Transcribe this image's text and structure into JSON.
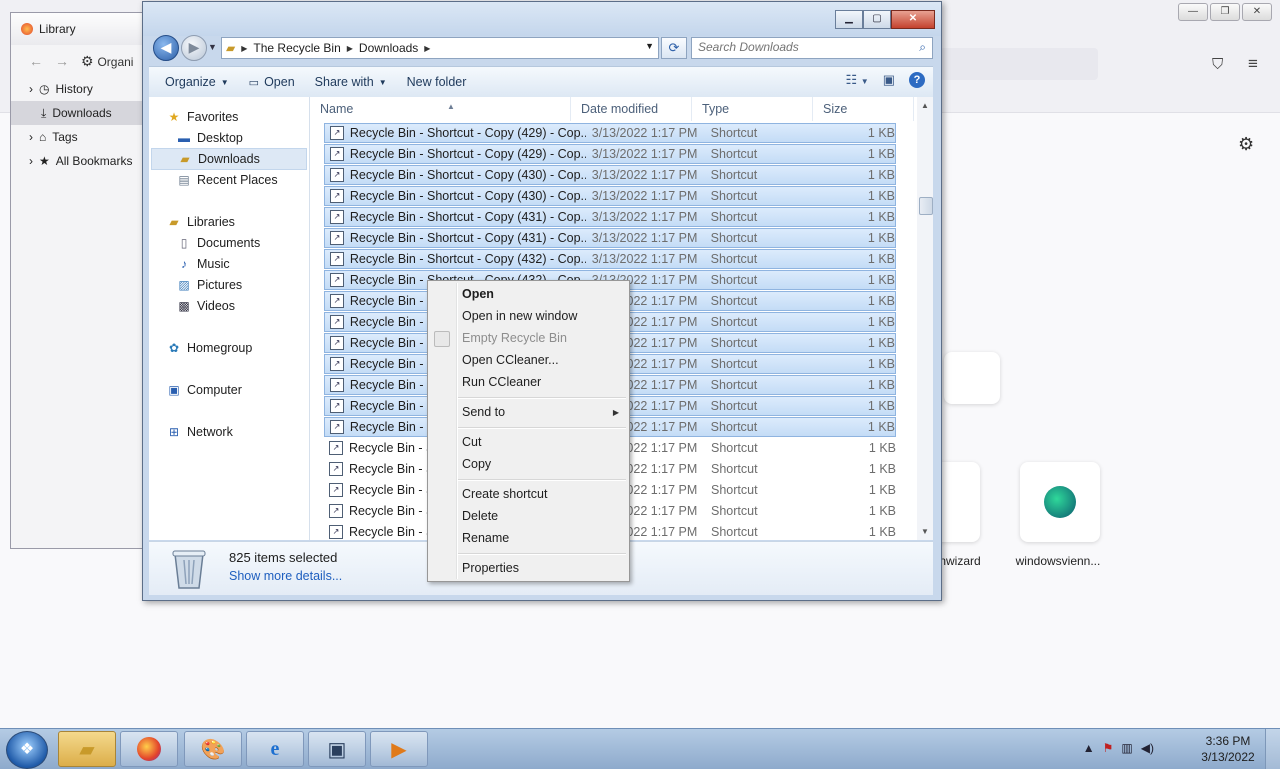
{
  "firefox": {
    "library_title": "Library",
    "library_toolbar_label": "Organi",
    "library_items": [
      "History",
      "Downloads",
      "Tags",
      "All Bookmarks"
    ],
    "tiles": [
      "nwizard",
      "windowsvienn..."
    ]
  },
  "explorer": {
    "breadcrumb": [
      "The Recycle Bin",
      "Downloads"
    ],
    "search_placeholder": "Search Downloads",
    "commands": {
      "organize": "Organize",
      "open": "Open",
      "share_with": "Share with",
      "new_folder": "New folder"
    },
    "nav_pane": {
      "favorites": "Favorites",
      "favorite_items": [
        "Desktop",
        "Downloads",
        "Recent Places"
      ],
      "libraries": "Libraries",
      "library_items": [
        "Documents",
        "Music",
        "Pictures",
        "Videos"
      ],
      "homegroup": "Homegroup",
      "computer": "Computer",
      "network": "Network"
    },
    "columns": {
      "name": "Name",
      "date": "Date modified",
      "type": "Type",
      "size": "Size"
    },
    "files": [
      {
        "name": "Recycle Bin - Shortcut - Copy (429) - Cop...",
        "date": "3/13/2022 1:17 PM",
        "type": "Shortcut",
        "size": "1 KB",
        "selected": true
      },
      {
        "name": "Recycle Bin - Shortcut - Copy (429) - Cop...",
        "date": "3/13/2022 1:17 PM",
        "type": "Shortcut",
        "size": "1 KB",
        "selected": true
      },
      {
        "name": "Recycle Bin - Shortcut - Copy (430) - Cop...",
        "date": "3/13/2022 1:17 PM",
        "type": "Shortcut",
        "size": "1 KB",
        "selected": true
      },
      {
        "name": "Recycle Bin - Shortcut - Copy (430) - Cop...",
        "date": "3/13/2022 1:17 PM",
        "type": "Shortcut",
        "size": "1 KB",
        "selected": true
      },
      {
        "name": "Recycle Bin - Shortcut - Copy (431) - Cop...",
        "date": "3/13/2022 1:17 PM",
        "type": "Shortcut",
        "size": "1 KB",
        "selected": true
      },
      {
        "name": "Recycle Bin - Shortcut - Copy (431) - Cop...",
        "date": "3/13/2022 1:17 PM",
        "type": "Shortcut",
        "size": "1 KB",
        "selected": true
      },
      {
        "name": "Recycle Bin - Shortcut - Copy (432) - Cop...",
        "date": "3/13/2022 1:17 PM",
        "type": "Shortcut",
        "size": "1 KB",
        "selected": true
      },
      {
        "name": "Recycle Bin - Shortcut - Copy (432) - Cop...",
        "date": "3/13/2022 1:17 PM",
        "type": "Shortcut",
        "size": "1 KB",
        "selected": true
      },
      {
        "name": "Recycle Bin - Sl",
        "date": "3/13/2022 1:17 PM",
        "type": "Shortcut",
        "size": "1 KB",
        "selected": true
      },
      {
        "name": "Recycle Bin - Sl",
        "date": "3/13/2022 1:17 PM",
        "type": "Shortcut",
        "size": "1 KB",
        "selected": true
      },
      {
        "name": "Recycle Bin - Sl",
        "date": "3/13/2022 1:17 PM",
        "type": "Shortcut",
        "size": "1 KB",
        "selected": true
      },
      {
        "name": "Recycle Bin - Sl",
        "date": "3/13/2022 1:17 PM",
        "type": "Shortcut",
        "size": "1 KB",
        "selected": true
      },
      {
        "name": "Recycle Bin - Sl",
        "date": "3/13/2022 1:17 PM",
        "type": "Shortcut",
        "size": "1 KB",
        "selected": true
      },
      {
        "name": "Recycle Bin - Sl",
        "date": "3/13/2022 1:17 PM",
        "type": "Shortcut",
        "size": "1 KB",
        "selected": true
      },
      {
        "name": "Recycle Bin - Sl",
        "date": "3/13/2022 1:17 PM",
        "type": "Shortcut",
        "size": "1 KB",
        "selected": true
      },
      {
        "name": "Recycle Bin - Sl",
        "date": "3/13/2022 1:17 PM",
        "type": "Shortcut",
        "size": "1 KB",
        "selected": false
      },
      {
        "name": "Recycle Bin - Sl",
        "date": "3/13/2022 1:17 PM",
        "type": "Shortcut",
        "size": "1 KB",
        "selected": false
      },
      {
        "name": "Recycle Bin - Sl",
        "date": "3/13/2022 1:17 PM",
        "type": "Shortcut",
        "size": "1 KB",
        "selected": false
      },
      {
        "name": "Recycle Bin - Sl",
        "date": "3/13/2022 1:17 PM",
        "type": "Shortcut",
        "size": "1 KB",
        "selected": false
      },
      {
        "name": "Recycle Bin - Sl",
        "date": "3/13/2022 1:17 PM",
        "type": "Shortcut",
        "size": "1 KB",
        "selected": false
      }
    ],
    "details": {
      "selected_count": "825 items selected",
      "more_details": "Show more details..."
    }
  },
  "context_menu": {
    "open": "Open",
    "open_new_window": "Open in new window",
    "empty_recycle_bin": "Empty Recycle Bin",
    "open_ccleaner": "Open CCleaner...",
    "run_ccleaner": "Run CCleaner",
    "send_to": "Send to",
    "cut": "Cut",
    "copy": "Copy",
    "create_shortcut": "Create shortcut",
    "delete": "Delete",
    "rename": "Rename",
    "properties": "Properties"
  },
  "taskbar": {
    "time": "3:36 PM",
    "date": "3/13/2022"
  }
}
